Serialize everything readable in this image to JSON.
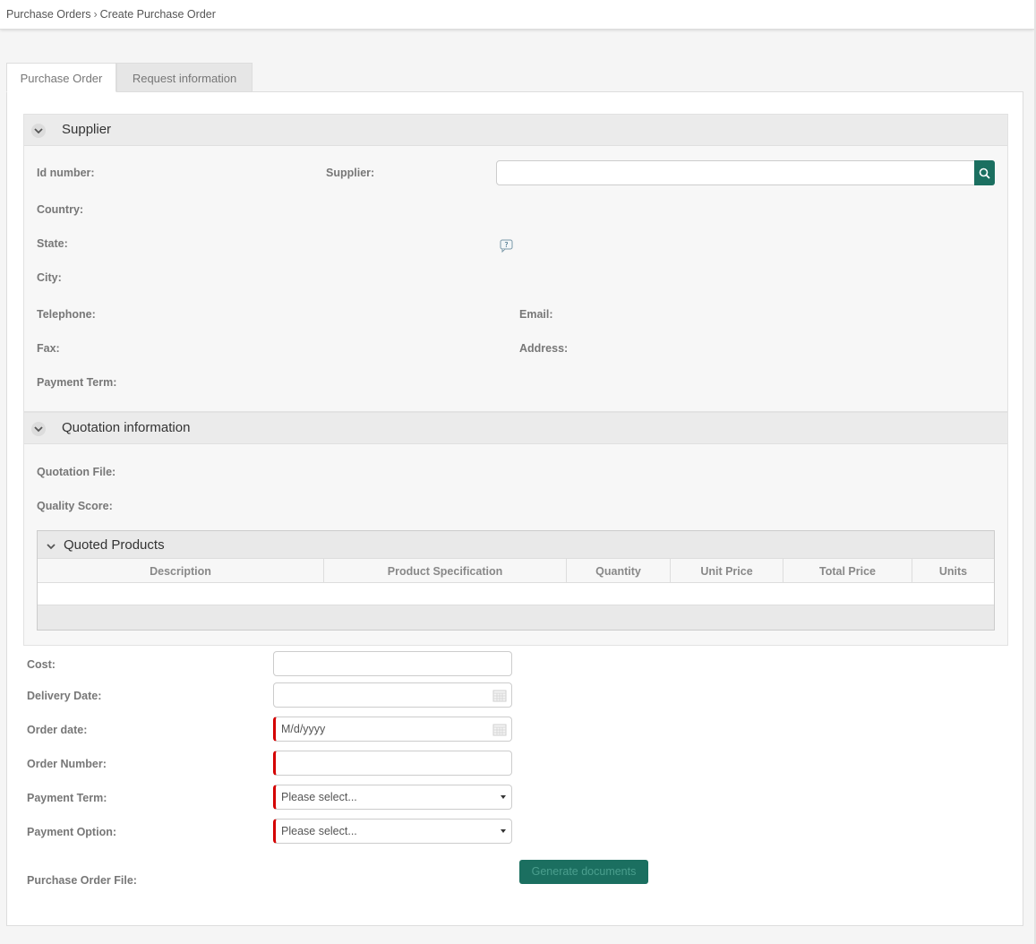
{
  "breadcrumb": {
    "parent": "Purchase Orders",
    "separator": "›",
    "current": "Create Purchase Order"
  },
  "tabs": [
    {
      "label": "Purchase Order"
    },
    {
      "label": "Request information"
    }
  ],
  "supplier_section": {
    "title": "Supplier",
    "labels": {
      "id_number": "Id number:",
      "supplier": "Supplier:",
      "country": "Country:",
      "state": "State:",
      "city": "City:",
      "telephone": "Telephone:",
      "email": "Email:",
      "fax": "Fax:",
      "address": "Address:",
      "payment_term": "Payment Term:"
    },
    "supplier_value": ""
  },
  "quotation_section": {
    "title": "Quotation information",
    "labels": {
      "quotation_file": "Quotation File:",
      "quality_score": "Quality Score:"
    },
    "grid": {
      "title": "Quoted Products",
      "columns": [
        "Description",
        "Product Specification",
        "Quantity",
        "Unit Price",
        "Total Price",
        "Units"
      ],
      "rows": []
    }
  },
  "form": {
    "cost": {
      "label": "Cost:",
      "value": ""
    },
    "delivery_date": {
      "label": "Delivery Date:",
      "value": ""
    },
    "order_date": {
      "label": "Order date:",
      "value": "M/d/yyyy"
    },
    "order_number": {
      "label": "Order Number:",
      "value": ""
    },
    "payment_term": {
      "label": "Payment Term:",
      "value": "Please select..."
    },
    "payment_option": {
      "label": "Payment Option:",
      "value": "Please select..."
    },
    "purchase_order_file": {
      "label": "Purchase Order File:"
    },
    "generate_button": "Generate documents"
  },
  "colors": {
    "accent": "#1b6f60",
    "required": "#d40000"
  }
}
